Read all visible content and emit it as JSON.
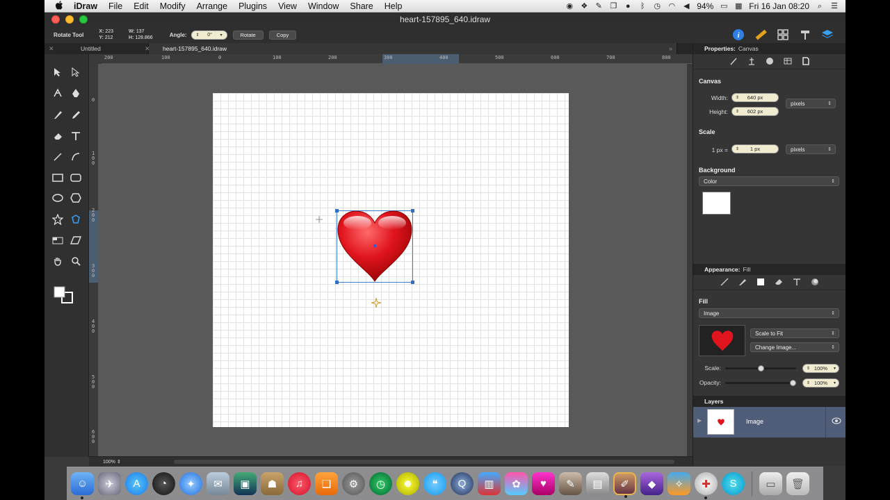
{
  "menubar": {
    "apple": "",
    "items": [
      "iDraw",
      "File",
      "Edit",
      "Modify",
      "Arrange",
      "Plugins",
      "View",
      "Window",
      "Share",
      "Help"
    ],
    "battery": "94%",
    "datetime": "Fri 16 Jan  08:20"
  },
  "window": {
    "title": "heart-157895_640.idraw"
  },
  "options": {
    "tool_name": "Rotate Tool",
    "x_label": "X:",
    "x_value": "223",
    "y_label": "Y:",
    "y_value": "212",
    "w_label": "W:",
    "w_value": "137",
    "h_label": "H:",
    "h_value": "128.866",
    "angle_label": "Angle:",
    "angle_value": "0°",
    "rotate_button": "Rotate",
    "copy_button": "Copy"
  },
  "tabs": [
    {
      "label": "Untitled"
    },
    {
      "label": "heart-157895_640.idraw"
    }
  ],
  "ruler_top": [
    "200",
    "100",
    "0",
    "100",
    "200",
    "300",
    "400",
    "500",
    "600",
    "700",
    "800"
  ],
  "ruler_left": [
    "0",
    "1\n0\n0",
    "2\n0\n0",
    "3\n0\n0",
    "4\n0\n0",
    "5\n0\n0",
    "6\n0\n0"
  ],
  "status": {
    "zoom": "100%"
  },
  "inspector": {
    "properties_label": "Properties:",
    "properties_target": "Canvas",
    "canvas_title": "Canvas",
    "width_label": "Width:",
    "width_value": "640 px",
    "height_label": "Height:",
    "height_value": "602 px",
    "units": "pixels",
    "scale_title": "Scale",
    "scale_prefix": "1 px =",
    "scale_value": "1 px",
    "scale_units": "pixels",
    "background_title": "Background",
    "background_type": "Color",
    "background_color": "#ffffff",
    "appearance_label": "Appearance:",
    "appearance_target": "Fill",
    "fill_title": "Fill",
    "fill_type": "Image",
    "fill_mode": "Scale to Fit",
    "change_image": "Change Image...",
    "scale_label": "Scale:",
    "scale_percent": "100%",
    "scale_slider": 0.5,
    "opacity_label": "Opacity:",
    "opacity_percent": "100%",
    "opacity_slider": 1.0,
    "layers_title": "Layers",
    "layer_name": "Image"
  },
  "colors": {
    "accent": "#2f6fc4",
    "heart": "#d8121b",
    "pill": "#f1eccf"
  }
}
